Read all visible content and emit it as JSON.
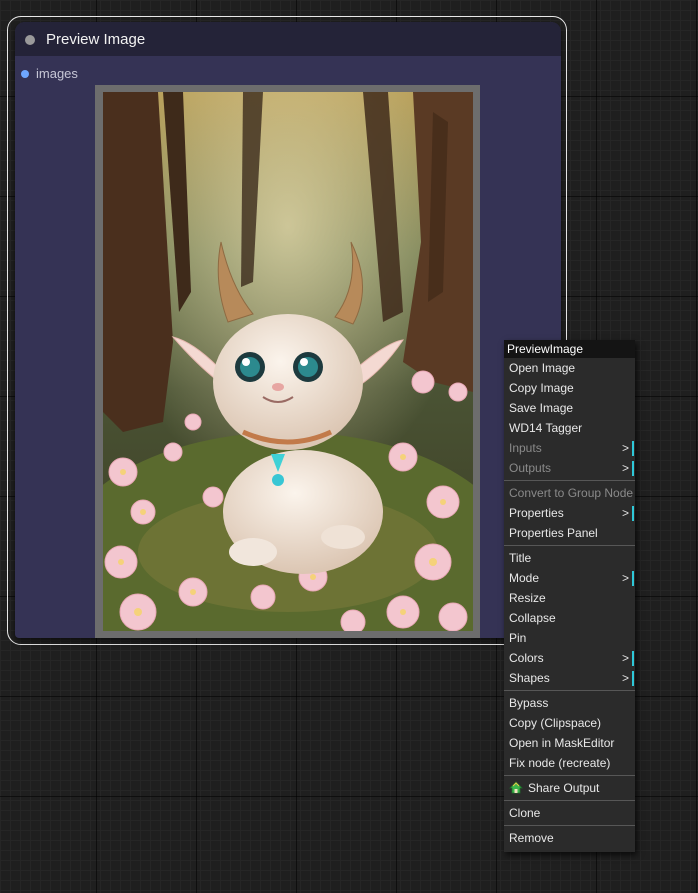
{
  "node": {
    "title": "Preview Image",
    "input_label": "images"
  },
  "context_menu": {
    "title": "PreviewImage",
    "groups": [
      [
        {
          "label": "Open Image"
        },
        {
          "label": "Copy Image"
        },
        {
          "label": "Save Image"
        },
        {
          "label": "WD14 Tagger"
        },
        {
          "label": "Inputs",
          "disabled": true,
          "submenu": true
        },
        {
          "label": "Outputs",
          "disabled": true,
          "submenu": true
        }
      ],
      [
        {
          "label": "Convert to Group Node",
          "disabled": true
        },
        {
          "label": "Properties",
          "submenu": true
        },
        {
          "label": "Properties Panel"
        }
      ],
      [
        {
          "label": "Title"
        },
        {
          "label": "Mode",
          "submenu": true
        },
        {
          "label": "Resize"
        },
        {
          "label": "Collapse"
        },
        {
          "label": "Pin"
        },
        {
          "label": "Colors",
          "submenu": true
        },
        {
          "label": "Shapes",
          "submenu": true
        }
      ],
      [
        {
          "label": "Bypass"
        },
        {
          "label": "Copy (Clipspace)"
        },
        {
          "label": "Open in MaskEditor"
        },
        {
          "label": "Fix node (recreate)"
        }
      ],
      [
        {
          "label": "Share Output",
          "icon": "share-house-icon"
        }
      ],
      [
        {
          "label": "Clone"
        }
      ],
      [
        {
          "label": "Remove"
        }
      ]
    ],
    "submenu_arrow": ">"
  },
  "colors": {
    "node_body": "#353355",
    "node_header": "#242338",
    "slot_input": "#6fa7ff",
    "submenu_accent": "#2ec8d8",
    "menu_bg": "#2b2b2b"
  }
}
